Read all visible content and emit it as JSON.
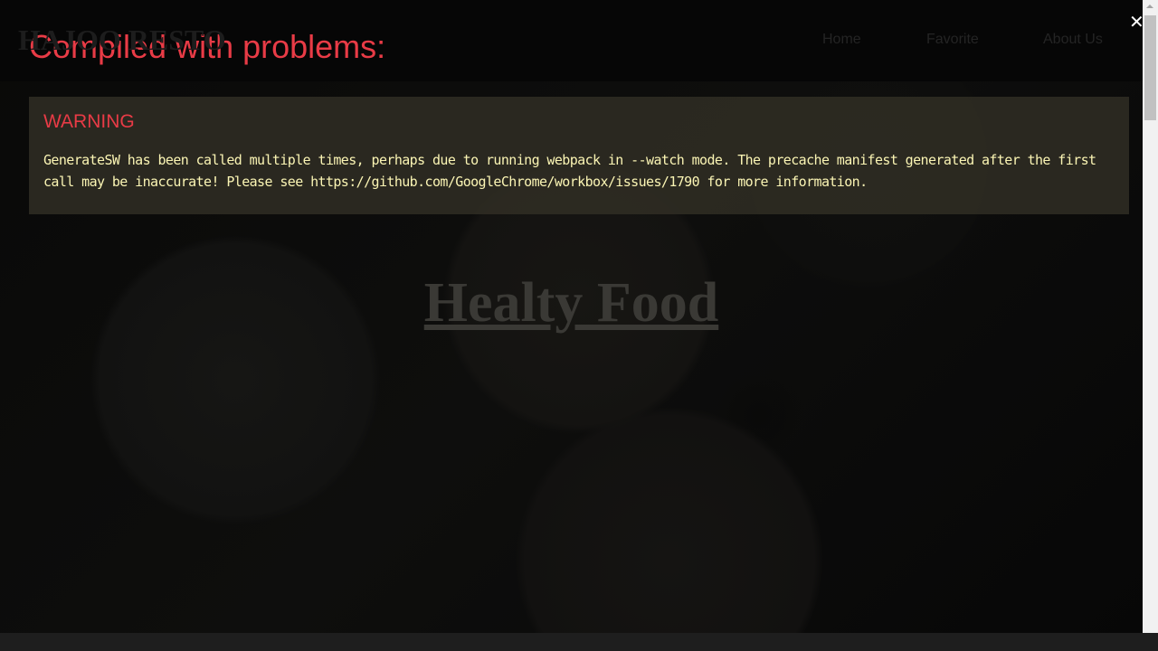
{
  "site": {
    "logo": "HAJOO RESTO",
    "nav": [
      "Home",
      "Favorite",
      "About Us"
    ],
    "hero_title": "Healty Food"
  },
  "overlay": {
    "title": "Compiled with problems:",
    "close_icon": "close-icon",
    "warning_label": "WARNING",
    "warning_message": "GenerateSW has been called multiple times, perhaps due to running webpack in --watch mode. The precache manifest generated after the first call may be inaccurate! Please see https://github.com/GoogleChrome/workbox/issues/1790 for more information.",
    "colors": {
      "error_red": "#e83b46",
      "message_yellow": "#fbf5b4"
    }
  }
}
